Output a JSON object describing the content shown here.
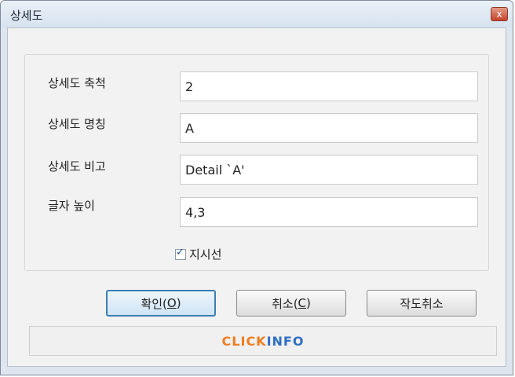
{
  "window": {
    "title": "상세도",
    "close_glyph": "x"
  },
  "fields": [
    {
      "label": "상세도 축척",
      "value": "2"
    },
    {
      "label": "상세도 명칭",
      "value": "A"
    },
    {
      "label": "상세도 비고",
      "value": "Detail `A'"
    },
    {
      "label": "글자 높이",
      "value": "4,3"
    }
  ],
  "leader_checkbox": {
    "label": "지시선",
    "checked": true
  },
  "buttons": {
    "ok": {
      "text": "확인(",
      "mnemonic": "O",
      "suffix": ")"
    },
    "cancel": {
      "text": "취소(",
      "mnemonic": "C",
      "suffix": ")"
    },
    "cancel_drawing": "작도취소"
  },
  "footer": {
    "brand_part1": "CLICK",
    "brand_part2": "INFO"
  },
  "colors": {
    "brand_orange": "#f07c1e",
    "brand_blue": "#2f6fc4",
    "default_button_border": "#3c7fb1"
  }
}
